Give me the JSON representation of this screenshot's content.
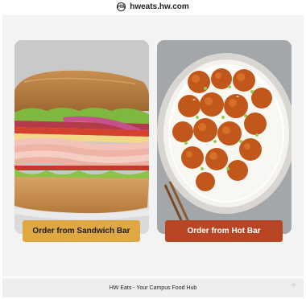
{
  "header": {
    "logo_text": "HW",
    "domain": "hweats.hw.com"
  },
  "cards": {
    "sandwich": {
      "image_icon": "sandwich-image",
      "button_label": "Order from Sandwich Bar",
      "button_color": "#dfa843"
    },
    "hotbar": {
      "image_icon": "orange-chicken-rice-image",
      "button_label": "Order from Hot Bar",
      "button_color": "#b84523"
    }
  },
  "footer": {
    "text": "HW Eats - Your Campus Food Hub"
  },
  "icons": {
    "sparkle": "sparkle-icon"
  }
}
